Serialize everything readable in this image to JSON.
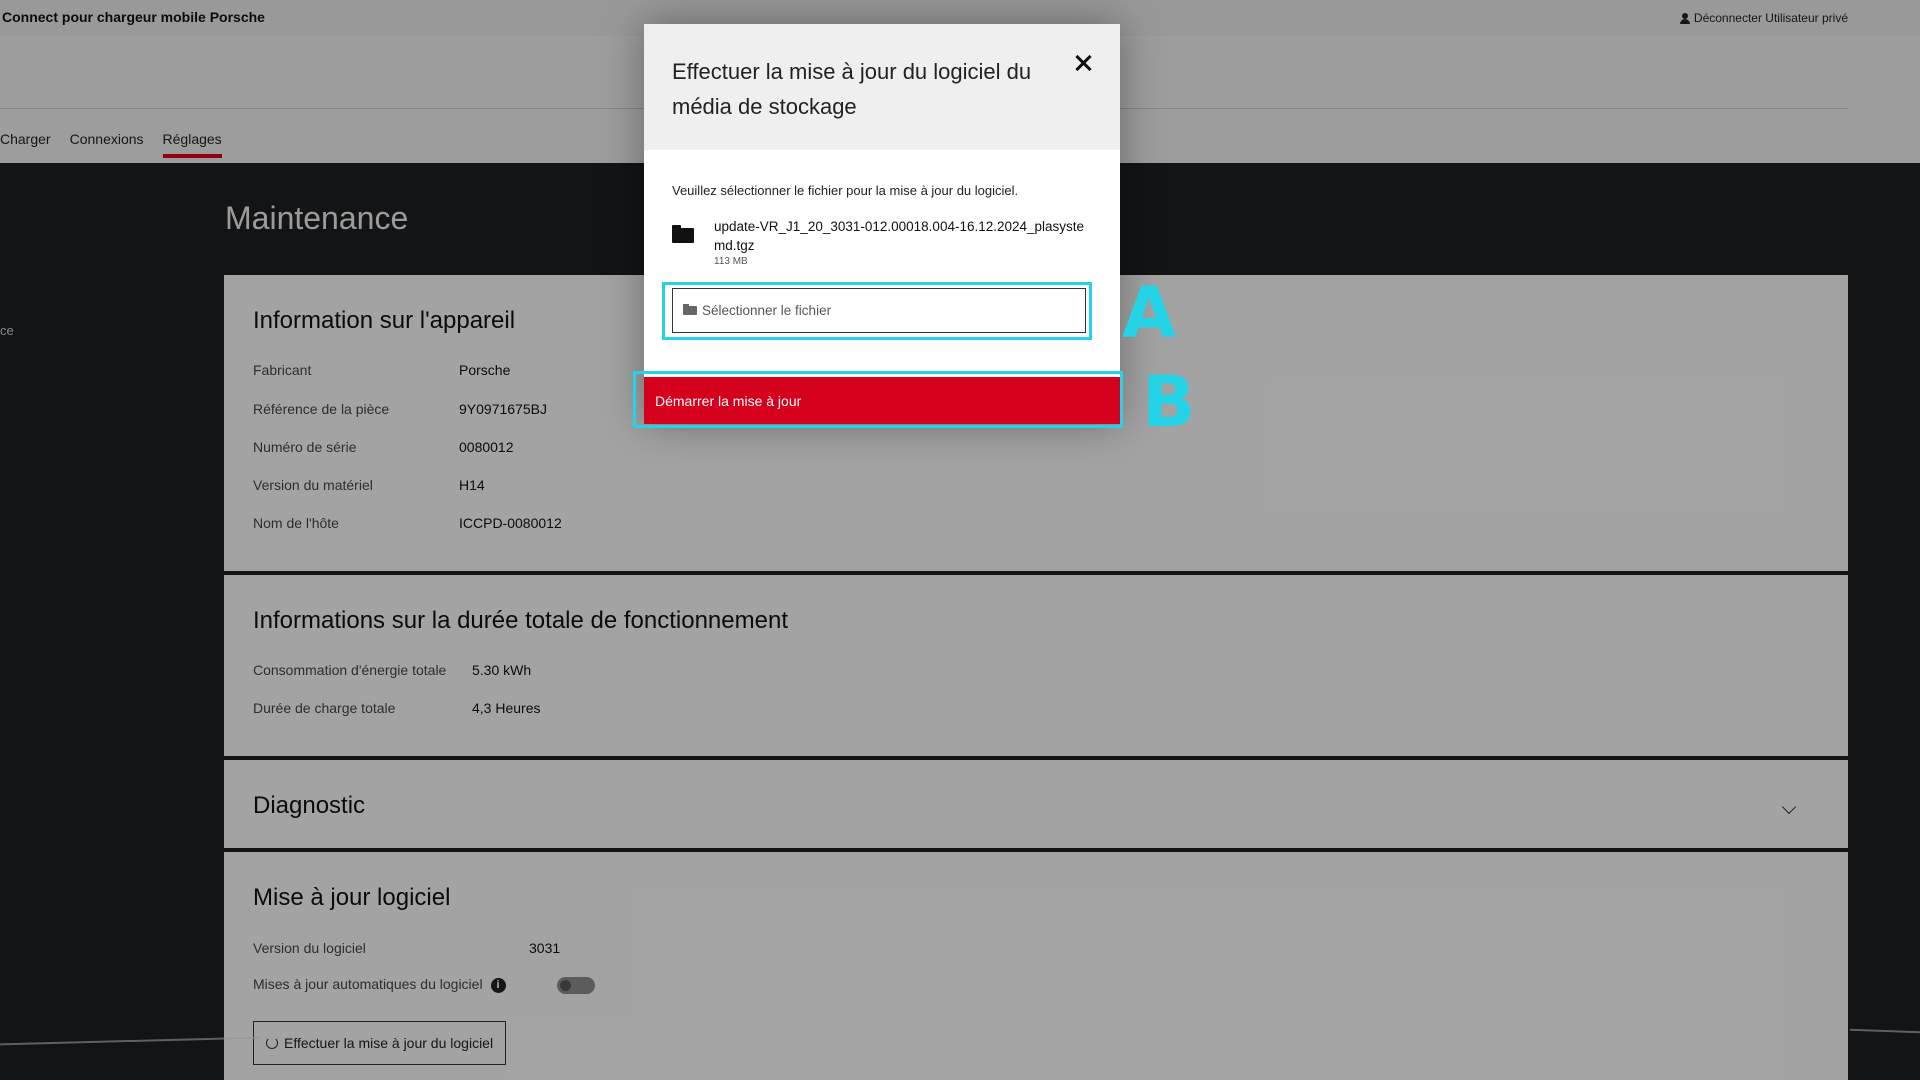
{
  "app": {
    "title": "Connect pour chargeur mobile Porsche",
    "logout_label": "Déconnecter Utilisateur privé"
  },
  "nav": {
    "items": [
      {
        "label": "Charger",
        "active": false
      },
      {
        "label": "Connexions",
        "active": false
      },
      {
        "label": "Réglages",
        "active": true
      }
    ]
  },
  "sidebar": {
    "fragment": "ce"
  },
  "page": {
    "title": "Maintenance"
  },
  "device_info": {
    "title": "Information sur l'appareil",
    "rows": [
      {
        "label": "Fabricant",
        "value": "Porsche"
      },
      {
        "label": "Référence de la pièce",
        "value": "9Y0971675BJ"
      },
      {
        "label": "Numéro de série",
        "value": "0080012"
      },
      {
        "label": "Version du matériel",
        "value": "H14"
      },
      {
        "label": "Nom de l'hôte",
        "value": "ICCPD-0080012"
      }
    ]
  },
  "runtime_info": {
    "title": "Informations sur la durée totale de fonctionnement",
    "rows": [
      {
        "label": "Consommation d'énergie totale",
        "value": "5.30 kWh"
      },
      {
        "label": "Durée de charge totale",
        "value": "4,3 Heures"
      }
    ]
  },
  "diagnostic": {
    "title": "Diagnostic"
  },
  "software_update": {
    "title": "Mise à jour logiciel",
    "version_label": "Version du logiciel",
    "version_value": "3031",
    "auto_update_label": "Mises à jour automatiques du logiciel",
    "auto_update_enabled": false,
    "button_label": "Effectuer la mise à jour du logiciel"
  },
  "modal": {
    "title": "Effectuer la mise à jour du logiciel du média de stockage",
    "description": "Veuillez sélectionner le fichier pour la mise à jour du logiciel.",
    "file_name": "update-VR_J1_20_3031-012.00018.004-16.12.2024_plasystemd.tgz",
    "file_size": "113 MB",
    "file_placeholder": "Sélectionner le fichier",
    "start_button": "Démarrer la mise à jour"
  },
  "annotations": {
    "a_label": "A",
    "b_label": "B",
    "color": "#24d4e6"
  },
  "colors": {
    "accent": "#d5001c",
    "dark_bg": "#1c1e22"
  }
}
